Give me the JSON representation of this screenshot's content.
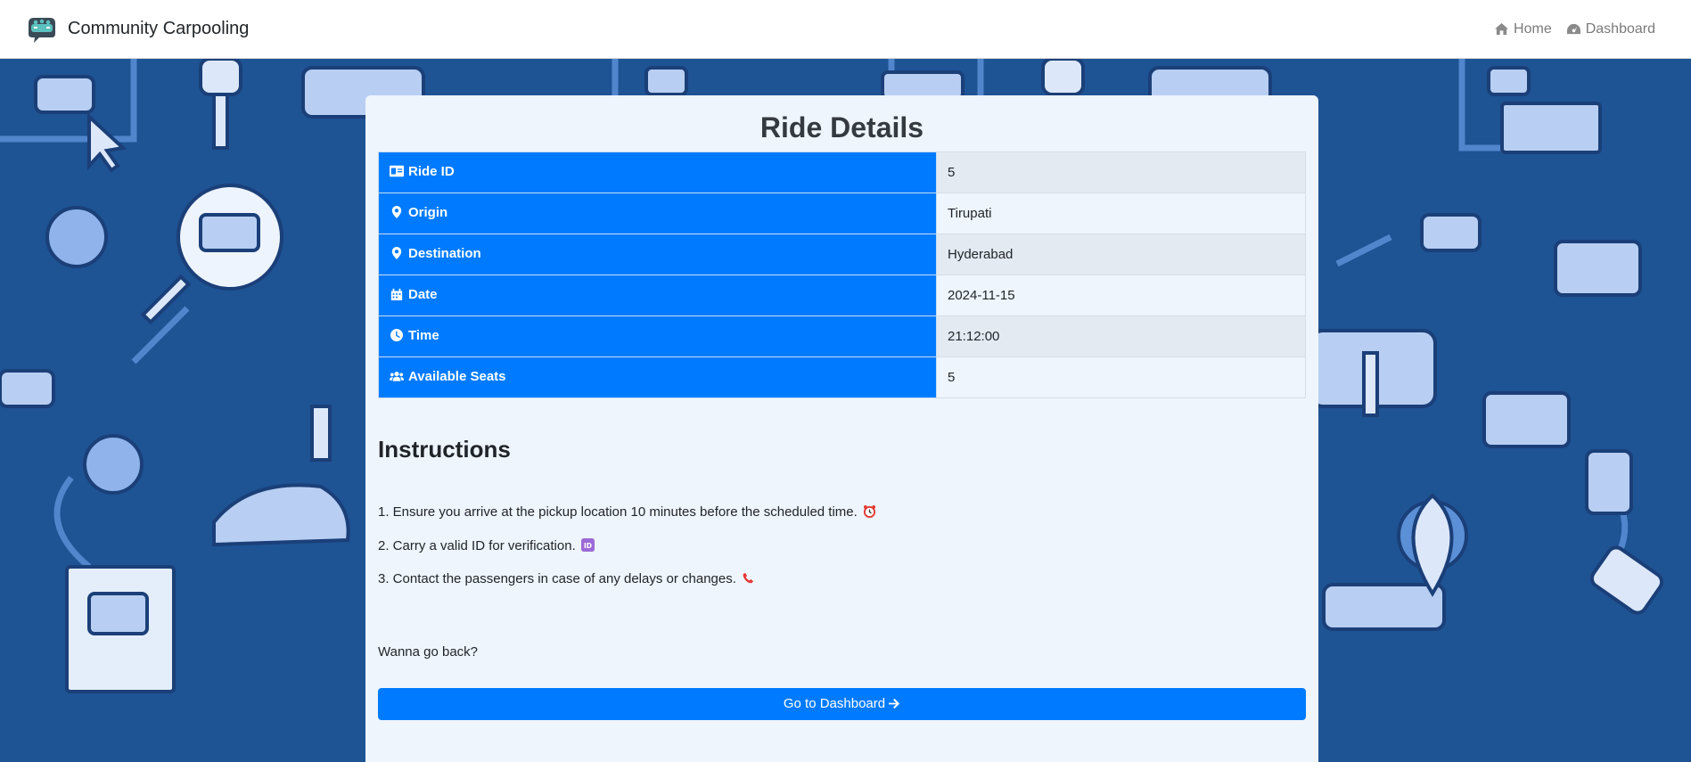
{
  "navbar": {
    "brand": "Community Carpooling",
    "links": [
      {
        "label": "Home",
        "icon": "home-icon"
      },
      {
        "label": "Dashboard",
        "icon": "dashboard-gauge-icon"
      }
    ]
  },
  "card": {
    "title": "Ride Details",
    "rows": [
      {
        "label": "Ride ID",
        "value": "5",
        "icon": "id-card-icon"
      },
      {
        "label": "Origin",
        "value": "Tirupati",
        "icon": "map-marker-icon"
      },
      {
        "label": "Destination",
        "value": "Hyderabad",
        "icon": "map-marker-icon"
      },
      {
        "label": "Date",
        "value": "2024-11-15",
        "icon": "calendar-icon"
      },
      {
        "label": "Time",
        "value": "21:12:00",
        "icon": "clock-icon"
      },
      {
        "label": "Available Seats",
        "value": "5",
        "icon": "users-icon"
      }
    ]
  },
  "instructions": {
    "title": "Instructions",
    "items": [
      {
        "text": "1. Ensure you arrive at the pickup location 10 minutes before the scheduled time.",
        "icon": "alarm-clock-emoji"
      },
      {
        "text": "2. Carry a valid ID for verification.",
        "icon": "id-emoji"
      },
      {
        "text": "3. Contact the passengers in case of any delays or changes.",
        "icon": "telephone-emoji"
      }
    ]
  },
  "footer": {
    "back_text": "Wanna go back?",
    "button_label": "Go to Dashboard"
  },
  "colors": {
    "primary": "#007bff",
    "background": "#1e5394",
    "card": "#eef5fc"
  }
}
